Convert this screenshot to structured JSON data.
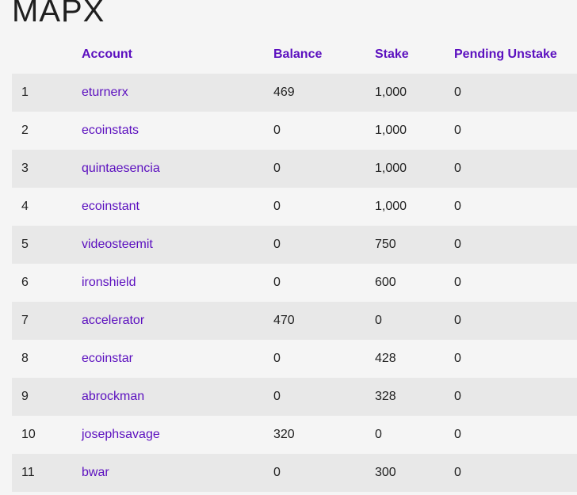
{
  "page": {
    "title": "MAPX"
  },
  "table": {
    "columns": {
      "rank": "",
      "account": "Account",
      "balance": "Balance",
      "stake": "Stake",
      "pending_unstake": "Pending Unstake"
    },
    "rows": [
      {
        "rank": "1",
        "account": "eturnerx",
        "balance": "469",
        "stake": "1,000",
        "pending_unstake": "0"
      },
      {
        "rank": "2",
        "account": "ecoinstats",
        "balance": "0",
        "stake": "1,000",
        "pending_unstake": "0"
      },
      {
        "rank": "3",
        "account": "quintaesencia",
        "balance": "0",
        "stake": "1,000",
        "pending_unstake": "0"
      },
      {
        "rank": "4",
        "account": "ecoinstant",
        "balance": "0",
        "stake": "1,000",
        "pending_unstake": "0"
      },
      {
        "rank": "5",
        "account": "videosteemit",
        "balance": "0",
        "stake": "750",
        "pending_unstake": "0"
      },
      {
        "rank": "6",
        "account": "ironshield",
        "balance": "0",
        "stake": "600",
        "pending_unstake": "0"
      },
      {
        "rank": "7",
        "account": "accelerator",
        "balance": "470",
        "stake": "0",
        "pending_unstake": "0"
      },
      {
        "rank": "8",
        "account": "ecoinstar",
        "balance": "0",
        "stake": "428",
        "pending_unstake": "0"
      },
      {
        "rank": "9",
        "account": "abrockman",
        "balance": "0",
        "stake": "328",
        "pending_unstake": "0"
      },
      {
        "rank": "10",
        "account": "josephsavage",
        "balance": "320",
        "stake": "0",
        "pending_unstake": "0"
      },
      {
        "rank": "11",
        "account": "bwar",
        "balance": "0",
        "stake": "300",
        "pending_unstake": "0"
      }
    ]
  },
  "colors": {
    "link": "#5b0fbf",
    "row_alt": "#e8e8e8",
    "background": "#f5f5f5"
  }
}
